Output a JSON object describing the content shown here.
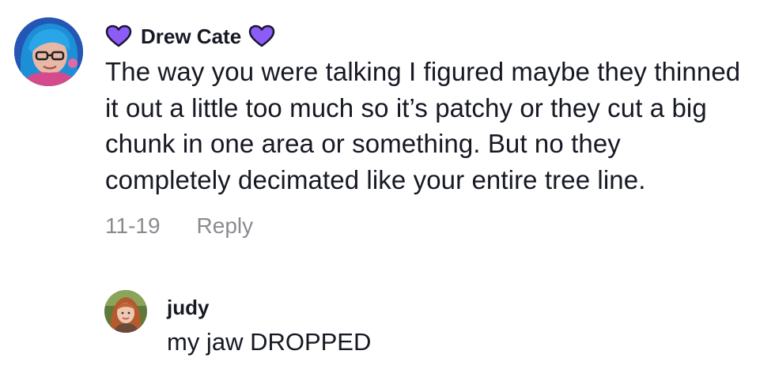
{
  "comment": {
    "username": "Drew Cate",
    "text": "The way you were talking I figured maybe they thinned it out a little too much so it’s patchy or they cut a big chunk in one area or something. But no they completely decimated like your entire tree line.",
    "date": "11-19",
    "reply_label": "Reply",
    "avatar_icon": "user-avatar-blue-hair-glasses",
    "badge_icon": "purple-heart-icon",
    "badge_color": "#8b5cf6"
  },
  "reply": {
    "username": "judy",
    "text": "my jaw DROPPED",
    "avatar_icon": "user-avatar-red-hair"
  }
}
